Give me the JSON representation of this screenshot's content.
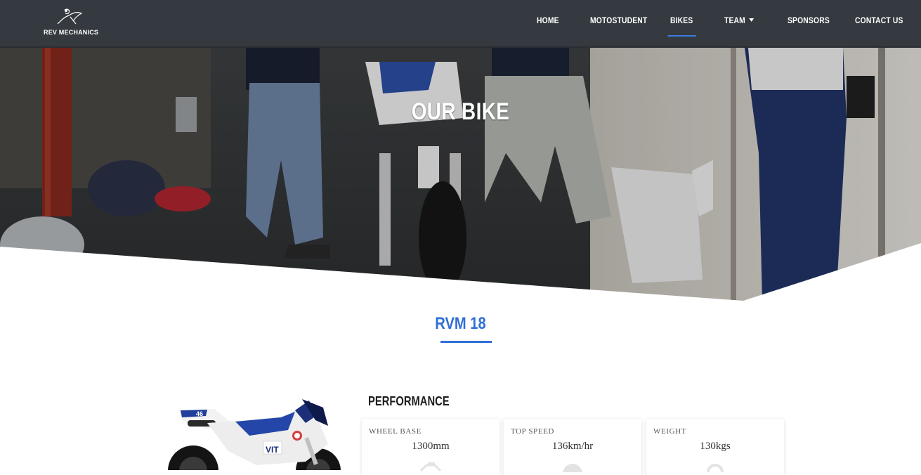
{
  "brand": {
    "name": "REV MECHANICS",
    "logo_icon": "rider-logo-icon"
  },
  "nav": {
    "items": [
      {
        "label": "HOME",
        "active": false
      },
      {
        "label": "MOTOSTUDENT",
        "active": false
      },
      {
        "label": "BIKES",
        "active": true
      },
      {
        "label": "TEAM",
        "active": false,
        "dropdown": true
      },
      {
        "label": "SPONSORS",
        "active": false
      },
      {
        "label": "CONTACT US",
        "active": false
      }
    ]
  },
  "hero": {
    "title": "OUR BIKE"
  },
  "bike": {
    "model": "RVM 18"
  },
  "performance": {
    "heading": "PERFORMANCE",
    "cards": [
      {
        "label": "WHEEL BASE",
        "value": "1300mm",
        "icon": "wheelbase-icon"
      },
      {
        "label": "TOP SPEED",
        "value": "136km/hr",
        "icon": "speedometer-icon"
      },
      {
        "label": "WEIGHT",
        "value": "130kgs",
        "icon": "weight-icon"
      }
    ]
  },
  "colors": {
    "accent": "#2f6fd6",
    "navbar": "#343a40"
  }
}
